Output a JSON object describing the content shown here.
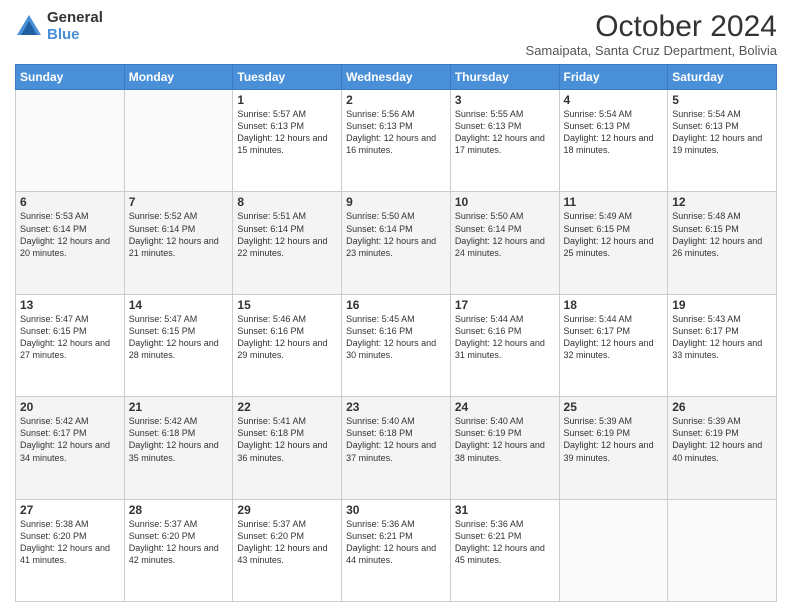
{
  "logo": {
    "general": "General",
    "blue": "Blue"
  },
  "header": {
    "month": "October 2024",
    "subtitle": "Samaipata, Santa Cruz Department, Bolivia"
  },
  "weekdays": [
    "Sunday",
    "Monday",
    "Tuesday",
    "Wednesday",
    "Thursday",
    "Friday",
    "Saturday"
  ],
  "weeks": [
    [
      {
        "day": "",
        "info": ""
      },
      {
        "day": "",
        "info": ""
      },
      {
        "day": "1",
        "info": "Sunrise: 5:57 AM\nSunset: 6:13 PM\nDaylight: 12 hours and 15 minutes."
      },
      {
        "day": "2",
        "info": "Sunrise: 5:56 AM\nSunset: 6:13 PM\nDaylight: 12 hours and 16 minutes."
      },
      {
        "day": "3",
        "info": "Sunrise: 5:55 AM\nSunset: 6:13 PM\nDaylight: 12 hours and 17 minutes."
      },
      {
        "day": "4",
        "info": "Sunrise: 5:54 AM\nSunset: 6:13 PM\nDaylight: 12 hours and 18 minutes."
      },
      {
        "day": "5",
        "info": "Sunrise: 5:54 AM\nSunset: 6:13 PM\nDaylight: 12 hours and 19 minutes."
      }
    ],
    [
      {
        "day": "6",
        "info": "Sunrise: 5:53 AM\nSunset: 6:14 PM\nDaylight: 12 hours and 20 minutes."
      },
      {
        "day": "7",
        "info": "Sunrise: 5:52 AM\nSunset: 6:14 PM\nDaylight: 12 hours and 21 minutes."
      },
      {
        "day": "8",
        "info": "Sunrise: 5:51 AM\nSunset: 6:14 PM\nDaylight: 12 hours and 22 minutes."
      },
      {
        "day": "9",
        "info": "Sunrise: 5:50 AM\nSunset: 6:14 PM\nDaylight: 12 hours and 23 minutes."
      },
      {
        "day": "10",
        "info": "Sunrise: 5:50 AM\nSunset: 6:14 PM\nDaylight: 12 hours and 24 minutes."
      },
      {
        "day": "11",
        "info": "Sunrise: 5:49 AM\nSunset: 6:15 PM\nDaylight: 12 hours and 25 minutes."
      },
      {
        "day": "12",
        "info": "Sunrise: 5:48 AM\nSunset: 6:15 PM\nDaylight: 12 hours and 26 minutes."
      }
    ],
    [
      {
        "day": "13",
        "info": "Sunrise: 5:47 AM\nSunset: 6:15 PM\nDaylight: 12 hours and 27 minutes."
      },
      {
        "day": "14",
        "info": "Sunrise: 5:47 AM\nSunset: 6:15 PM\nDaylight: 12 hours and 28 minutes."
      },
      {
        "day": "15",
        "info": "Sunrise: 5:46 AM\nSunset: 6:16 PM\nDaylight: 12 hours and 29 minutes."
      },
      {
        "day": "16",
        "info": "Sunrise: 5:45 AM\nSunset: 6:16 PM\nDaylight: 12 hours and 30 minutes."
      },
      {
        "day": "17",
        "info": "Sunrise: 5:44 AM\nSunset: 6:16 PM\nDaylight: 12 hours and 31 minutes."
      },
      {
        "day": "18",
        "info": "Sunrise: 5:44 AM\nSunset: 6:17 PM\nDaylight: 12 hours and 32 minutes."
      },
      {
        "day": "19",
        "info": "Sunrise: 5:43 AM\nSunset: 6:17 PM\nDaylight: 12 hours and 33 minutes."
      }
    ],
    [
      {
        "day": "20",
        "info": "Sunrise: 5:42 AM\nSunset: 6:17 PM\nDaylight: 12 hours and 34 minutes."
      },
      {
        "day": "21",
        "info": "Sunrise: 5:42 AM\nSunset: 6:18 PM\nDaylight: 12 hours and 35 minutes."
      },
      {
        "day": "22",
        "info": "Sunrise: 5:41 AM\nSunset: 6:18 PM\nDaylight: 12 hours and 36 minutes."
      },
      {
        "day": "23",
        "info": "Sunrise: 5:40 AM\nSunset: 6:18 PM\nDaylight: 12 hours and 37 minutes."
      },
      {
        "day": "24",
        "info": "Sunrise: 5:40 AM\nSunset: 6:19 PM\nDaylight: 12 hours and 38 minutes."
      },
      {
        "day": "25",
        "info": "Sunrise: 5:39 AM\nSunset: 6:19 PM\nDaylight: 12 hours and 39 minutes."
      },
      {
        "day": "26",
        "info": "Sunrise: 5:39 AM\nSunset: 6:19 PM\nDaylight: 12 hours and 40 minutes."
      }
    ],
    [
      {
        "day": "27",
        "info": "Sunrise: 5:38 AM\nSunset: 6:20 PM\nDaylight: 12 hours and 41 minutes."
      },
      {
        "day": "28",
        "info": "Sunrise: 5:37 AM\nSunset: 6:20 PM\nDaylight: 12 hours and 42 minutes."
      },
      {
        "day": "29",
        "info": "Sunrise: 5:37 AM\nSunset: 6:20 PM\nDaylight: 12 hours and 43 minutes."
      },
      {
        "day": "30",
        "info": "Sunrise: 5:36 AM\nSunset: 6:21 PM\nDaylight: 12 hours and 44 minutes."
      },
      {
        "day": "31",
        "info": "Sunrise: 5:36 AM\nSunset: 6:21 PM\nDaylight: 12 hours and 45 minutes."
      },
      {
        "day": "",
        "info": ""
      },
      {
        "day": "",
        "info": ""
      }
    ]
  ]
}
